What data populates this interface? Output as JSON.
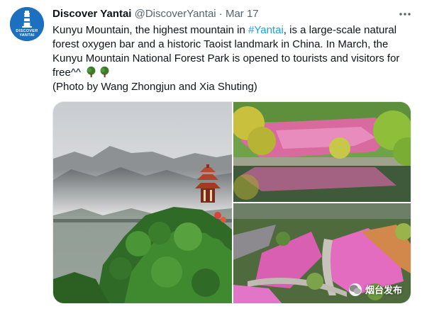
{
  "tweet": {
    "author": {
      "display_name": "Discover Yantai",
      "handle": "@DiscoverYantai",
      "avatar_label_line1": "DISCOVER",
      "avatar_label_line2": "YANTAI",
      "avatar_icon": "lighthouse-icon"
    },
    "separator": "·",
    "date": "Mar 17",
    "more_icon": "more-dots-icon",
    "text": {
      "before_hashtag": "Kunyu Mountain, the highest mountain in ",
      "hashtag": "#Yantai",
      "after_hashtag": ", is a large-scale natural forest oxygen bar and a historic Taoist landmark in China. In March, the Kunyu Mountain National Forest Park is opened to tourists and visitors for free^^",
      "emoji": "tree-emoji",
      "credit": "(Photo by Wang Zhongjun and Xia Shuting)"
    },
    "media": {
      "photos": [
        {
          "subject": "misty-mountain-pavilion"
        },
        {
          "subject": "pink-flower-field-lake"
        },
        {
          "subject": "aerial-pink-flower-fields"
        }
      ],
      "watermark": "烟台发布",
      "watermark_icon": "wechat-icon"
    }
  },
  "colors": {
    "text": "#0f1419",
    "secondary": "#536471",
    "link": "#1d9bf0",
    "avatar_bg": "#1d6fbf"
  }
}
